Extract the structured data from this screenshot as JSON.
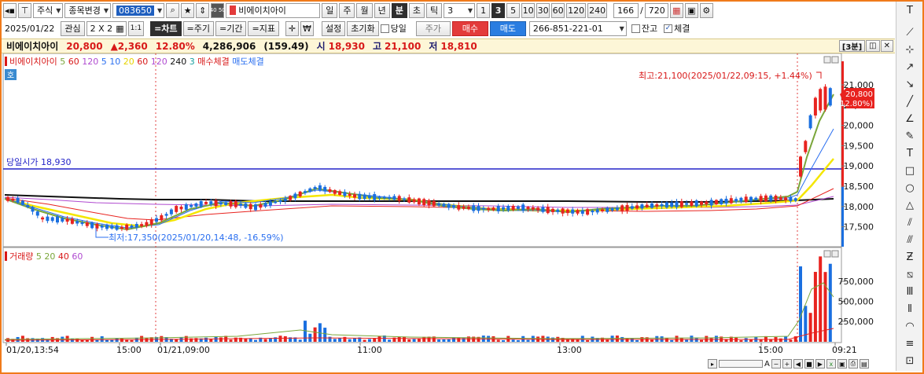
{
  "toolbar1": {
    "market": "주식",
    "search_mode": "종목변경",
    "code": "083650",
    "stock_name": "비에이치아이",
    "periods": [
      "일",
      "주",
      "월",
      "년",
      "분",
      "초",
      "틱"
    ],
    "active_period": "분",
    "period_value": "3",
    "intervals": [
      "1",
      "3",
      "5",
      "10",
      "30",
      "60",
      "120",
      "240"
    ],
    "active_interval": "3",
    "count_shown": "166",
    "count_sep": "/",
    "count_total": "720",
    "mini_label": "40 50"
  },
  "toolbar2": {
    "date": "2025/01/22",
    "watch_label": "관심",
    "grid_label": "2 X 2",
    "one_label": "1:1",
    "chart_btn": "=차트",
    "period_btn": "=주기",
    "range_btn": "=기간",
    "indicator_btn": "=지표",
    "settings_btn": "설정",
    "reset_btn": "초기화",
    "today_label": "당일",
    "price_btn": "주가",
    "buy_btn": "매수",
    "sell_btn": "매도",
    "account": "266-851-221-01",
    "balance_label": "잔고",
    "fill_label": "체결"
  },
  "info": {
    "name": "비에이치아이",
    "price": "20,800",
    "change": "▲2,360",
    "change_pct": "12.80%",
    "volume": "4,286,906",
    "volume_ratio": "(159.49)",
    "open_label": "시",
    "open": "18,930",
    "high_label": "고",
    "high": "21,100",
    "low_label": "저",
    "low": "18,810",
    "interval_tag": "[3분]"
  },
  "price_panel": {
    "badge": "호",
    "legend": [
      {
        "text": "비에이치아이",
        "color": "#d81919"
      },
      {
        "text": "5",
        "color": "#7aa63a"
      },
      {
        "text": "60",
        "color": "#d81919"
      },
      {
        "text": "120",
        "color": "#b04bd0"
      },
      {
        "text": "5",
        "color": "#2a6ff0"
      },
      {
        "text": "10",
        "color": "#2a6ff0"
      },
      {
        "text": "20",
        "color": "#e6d200"
      },
      {
        "text": "60",
        "color": "#d81919"
      },
      {
        "text": "120",
        "color": "#b04bd0"
      },
      {
        "text": "240",
        "color": "#111111"
      },
      {
        "text": "3",
        "color": "#18a0a0"
      },
      {
        "text": "매수체결",
        "color": "#d81919"
      },
      {
        "text": "매도체결",
        "color": "#2a6ff0"
      }
    ],
    "high_note": "최고:21,100(2025/01/22,09:15, +1.44%)",
    "low_note": "최저:17,350(2025/01/20,14:48, -16.59%)",
    "open_line_label": "당일시가 18,930",
    "current_price_tag": "20,800",
    "current_pct_tag": "( 12.80%)",
    "y_ticks": [
      "21,000",
      "20,500",
      "20,000",
      "19,500",
      "19,000",
      "18,500",
      "18,000",
      "17,500"
    ]
  },
  "volume_panel": {
    "legend": [
      {
        "text": "거래량",
        "color": "#d81919"
      },
      {
        "text": "5",
        "color": "#7aa63a"
      },
      {
        "text": "20",
        "color": "#7aa63a"
      },
      {
        "text": "40",
        "color": "#d81919"
      },
      {
        "text": "60",
        "color": "#b04bd0"
      }
    ],
    "y_ticks": [
      "750,000",
      "500,000",
      "250,000"
    ]
  },
  "x_axis": [
    "01/20,13:54",
    "15:00",
    "01/21,09:00",
    "11:00",
    "13:00",
    "15:00",
    "09:21"
  ],
  "colors": {
    "up": "#e8231f",
    "down": "#1a6fe0",
    "ma5": "#7aa63a",
    "ma20": "#f4e600",
    "ma240": "#111111",
    "open_line": "#2424c8",
    "frame": "#f07a1a"
  }
}
